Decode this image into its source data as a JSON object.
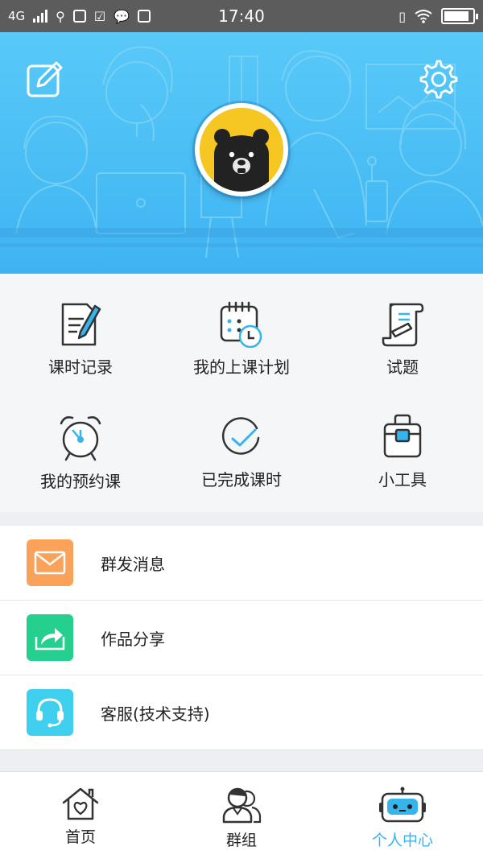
{
  "status_bar": {
    "network": "4G",
    "time": "17:40",
    "battery_level": 0.9
  },
  "header": {
    "edit_icon": "edit-icon",
    "settings_icon": "gear-icon",
    "avatar": "bear-avatar",
    "background_color": "#4cc0f5"
  },
  "quick_actions": [
    {
      "label": "课时记录",
      "icon": "lesson-record-icon"
    },
    {
      "label": "我的上课计划",
      "icon": "calendar-plan-icon"
    },
    {
      "label": "试题",
      "icon": "scroll-exam-icon"
    },
    {
      "label": "我的预约课",
      "icon": "alarm-clock-icon"
    },
    {
      "label": "已完成课时",
      "icon": "check-circle-icon"
    },
    {
      "label": "小工具",
      "icon": "toolbox-icon"
    }
  ],
  "menu": [
    {
      "label": "群发消息",
      "icon": "mail-icon",
      "color": "#fba25a"
    },
    {
      "label": "作品分享",
      "icon": "share-icon",
      "color": "#25d08f"
    },
    {
      "label": "客服(技术支持)",
      "icon": "headset-icon",
      "color": "#3ed0ee"
    }
  ],
  "tabs": [
    {
      "label": "首页",
      "icon": "home-icon"
    },
    {
      "label": "群组",
      "icon": "group-icon"
    },
    {
      "label": "个人中心",
      "icon": "robot-icon"
    }
  ],
  "active_tab": "个人中心",
  "accent_color": "#36b4ec"
}
